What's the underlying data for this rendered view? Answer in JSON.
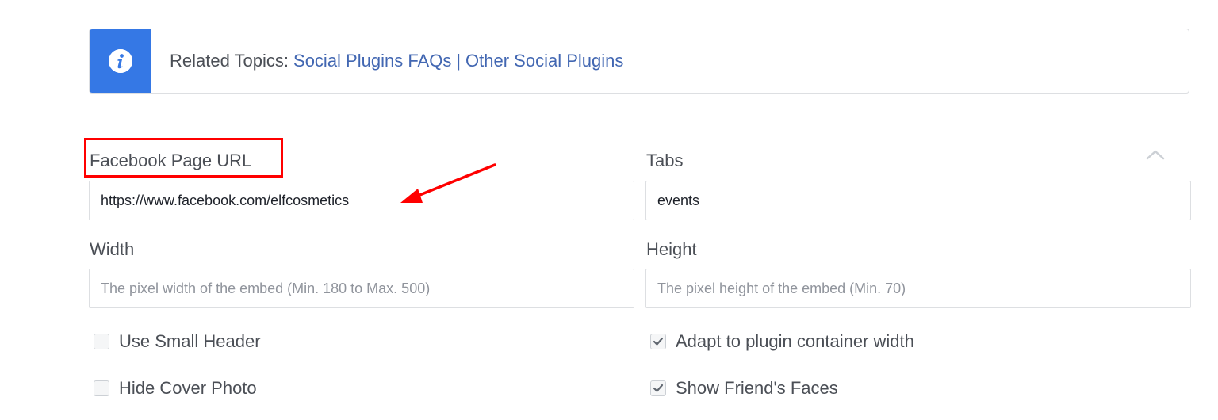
{
  "banner": {
    "icon": "info-icon",
    "label": "Related Topics:",
    "link_faq": "Social Plugins FAQs",
    "separator": "|",
    "link_other": "Other Social Plugins",
    "icon_color": "#3578e5",
    "link_color": "#4267b2"
  },
  "form": {
    "page_url": {
      "label": "Facebook Page URL",
      "value": "https://www.facebook.com/elfcosmetics"
    },
    "tabs": {
      "label": "Tabs",
      "value": "events"
    },
    "width": {
      "label": "Width",
      "placeholder": "The pixel width of the embed (Min. 180 to Max. 500)"
    },
    "height": {
      "label": "Height",
      "placeholder": "The pixel height of the embed (Min. 70)"
    },
    "checkboxes": {
      "small_header": {
        "label": "Use Small Header",
        "checked": false
      },
      "hide_cover": {
        "label": "Hide Cover Photo",
        "checked": false
      },
      "adapt_width": {
        "label": "Adapt to plugin container width",
        "checked": true
      },
      "friend_faces": {
        "label": "Show Friend's Faces",
        "checked": true
      }
    }
  },
  "annotation": {
    "color": "#ff0000"
  }
}
